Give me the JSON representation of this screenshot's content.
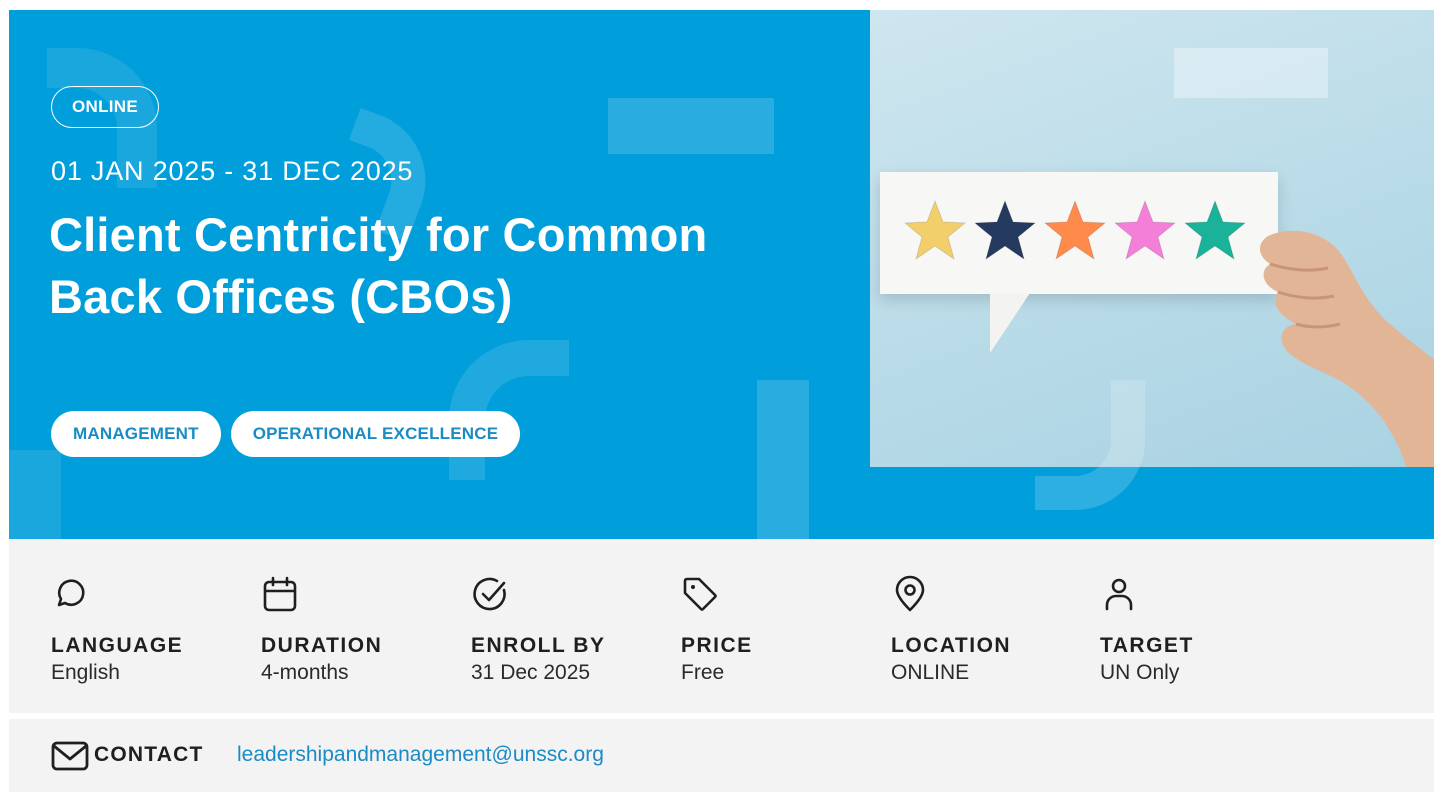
{
  "hero": {
    "mode": "ONLINE",
    "dates": "01 JAN 2025 - 31 DEC 2025",
    "title": "Client Centricity for Common Back Offices (CBOs)",
    "tags": [
      "MANAGEMENT",
      "OPERATIONAL EXCELLENCE"
    ],
    "background_color": "#009edb"
  },
  "photo": {
    "star_colors": [
      "#f2cf6a",
      "#243a5e",
      "#ff8a4c",
      "#f47fd8",
      "#1ab39a"
    ],
    "rating": 5,
    "rating_max": 5
  },
  "info": [
    {
      "icon": "speech-bubble-icon",
      "label": "LANGUAGE",
      "value": "English"
    },
    {
      "icon": "calendar-icon",
      "label": "DURATION",
      "value": "4-months"
    },
    {
      "icon": "check-circle-icon",
      "label": "ENROLL BY",
      "value": "31 Dec 2025"
    },
    {
      "icon": "price-tag-icon",
      "label": "PRICE",
      "value": "Free"
    },
    {
      "icon": "map-pin-icon",
      "label": "LOCATION",
      "value": "ONLINE"
    },
    {
      "icon": "person-icon",
      "label": "TARGET",
      "value": "UN Only"
    }
  ],
  "contact": {
    "icon": "envelope-icon",
    "label": "CONTACT",
    "email": "leadershipandmanagement@unssc.org",
    "link_color": "#1a8bc4"
  }
}
